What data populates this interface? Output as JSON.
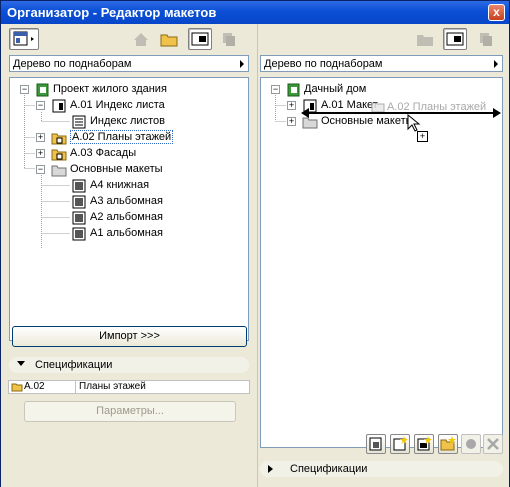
{
  "window": {
    "title": "Организатор - Редактор макетов",
    "close_label": "x"
  },
  "left": {
    "dropdown": "Дерево по поднаборам",
    "tree": [
      {
        "label": "Проект жилого здания",
        "icon": "project-book-icon"
      },
      {
        "label": "A.01  Индекс листа",
        "icon": "sheet-icon"
      },
      {
        "label": "Индекс листов",
        "icon": "index-sheet-icon"
      },
      {
        "label": "A.02 Планы этажей",
        "icon": "folder-sheet-icon"
      },
      {
        "label": "A.03 Фасады",
        "icon": "folder-sheet-icon"
      },
      {
        "label": "Основные макеты",
        "icon": "folder-icon"
      },
      {
        "label": "A4 книжная",
        "icon": "layout-icon"
      },
      {
        "label": "A3 альбомная",
        "icon": "layout-icon"
      },
      {
        "label": "A2 альбомная",
        "icon": "layout-icon"
      },
      {
        "label": "A1 альбомная",
        "icon": "layout-icon"
      }
    ],
    "import_button": "Импорт >>>",
    "spec_title": "Спецификации",
    "spec_row": {
      "id": "A.02",
      "name": "Планы этажей"
    },
    "params_button": "Параметры..."
  },
  "right": {
    "dropdown": "Дерево по поднаборам",
    "tree": [
      {
        "label": "Дачный дом",
        "icon": "project-book-icon"
      },
      {
        "label": "A.01 Макет",
        "icon": "sheet-icon"
      },
      {
        "label": "Основные макеты",
        "icon": "folder-icon"
      }
    ],
    "drag_ghost": "A.02 Планы этажей",
    "drag_plus": "+",
    "spec_title": "Спецификации"
  },
  "colors": {
    "title_bar": "#0a4fd6",
    "tree_border": "#7f9db9",
    "selection": "#316ac5"
  }
}
